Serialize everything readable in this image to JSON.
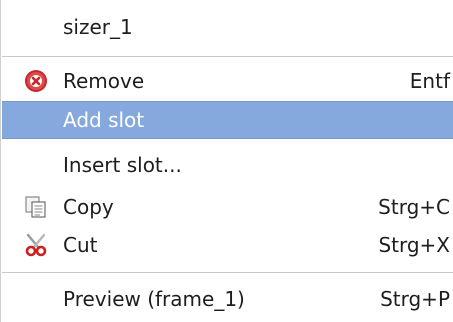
{
  "menu": {
    "header": {
      "label": "sizer_1"
    },
    "items": [
      {
        "label": "Remove",
        "shortcut": "Entf",
        "icon": "remove-icon",
        "highlighted": false
      },
      {
        "label": "Add slot",
        "shortcut": "",
        "icon": "",
        "highlighted": true
      },
      {
        "label": "Insert slot...",
        "shortcut": "",
        "icon": "",
        "highlighted": false
      },
      {
        "label": "Copy",
        "shortcut": "Strg+C",
        "icon": "copy-icon",
        "highlighted": false
      },
      {
        "label": "Cut",
        "shortcut": "Strg+X",
        "icon": "scissors-icon",
        "highlighted": false
      },
      {
        "label": "Preview (frame_1)",
        "shortcut": "Strg+P",
        "icon": "",
        "highlighted": false
      }
    ]
  },
  "colors": {
    "highlight": "#86a9dd",
    "text": "#1e1e1e",
    "highlight_text": "#ffffff",
    "remove_icon": "#d22a2a"
  }
}
